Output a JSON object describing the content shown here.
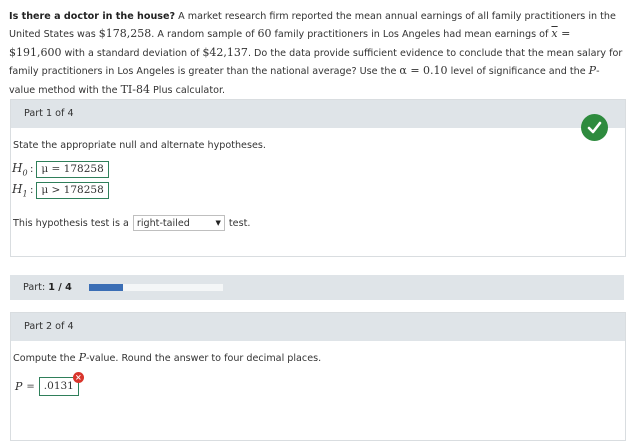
{
  "problem": {
    "lead_bold": "Is there a doctor in the house?",
    "t1": " A market research firm reported the mean annual earnings of all family practitioners in the United States was ",
    "national_mean": "$178,258",
    "t2": ". A random sample of ",
    "n": "60",
    "t3": " family practitioners in Los Angeles had mean earnings of ",
    "xbar_symbol": "x",
    "xbar_value": " = $191,600",
    "t4": " with a standard deviation of ",
    "sd": "$42,137",
    "t5": ". Do the data provide sufficient evidence to conclude that the mean salary for family practitioners in Los Angeles is greater than the national average? Use the ",
    "alpha": "α = 0.10",
    "t6": " level of significance and the ",
    "p_italic": "P",
    "t7": "-value method with the ",
    "calc": "TI-84",
    "t8": " Plus calculator."
  },
  "part1": {
    "header": "Part 1 of 4",
    "instruction": "State the appropriate null and alternate hypotheses.",
    "h0_symbol": "H",
    "h0_sub": "0",
    "h0_expr": "μ = 178258",
    "h1_symbol": "H",
    "h1_sub": "1",
    "h1_expr": "μ > 178258",
    "test_prefix": "This hypothesis test is a",
    "test_selected": "right-tailed",
    "test_suffix": "test.",
    "status_icon": "checkmark-icon",
    "status_color": "#2e8b3e"
  },
  "progress": {
    "label_prefix": "Part:",
    "label_value": "1 / 4",
    "fraction": 0.25,
    "bar_color": "#3b6eb5"
  },
  "part2": {
    "header": "Part 2 of 4",
    "instruction_a": "Compute the ",
    "instruction_p": "P",
    "instruction_b": "-value. Round the answer to four decimal places.",
    "p_label": "P",
    "p_value": ".0131",
    "error_icon": "error-x-icon",
    "error_color": "#d9352c"
  }
}
